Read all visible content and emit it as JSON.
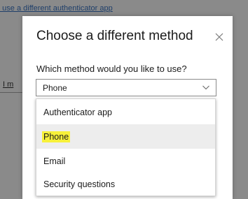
{
  "background": {
    "top_link": "o use a different authenticator app",
    "left_link": "I m"
  },
  "dialog": {
    "title": "Choose a different method",
    "close_icon": "close-icon",
    "question": "Which method would you like to use?",
    "select": {
      "value": "Phone",
      "chevron_icon": "chevron-down-icon"
    }
  },
  "dropdown": {
    "options": [
      {
        "label": "Authenticator app",
        "selected": false
      },
      {
        "label": "Phone",
        "selected": true,
        "highlighted": true
      },
      {
        "label": "Email",
        "selected": false
      },
      {
        "label": "Security questions",
        "selected": false
      }
    ]
  },
  "colors": {
    "overlay": "#6f6f6f",
    "highlight": "#f7f13a",
    "selected_row": "#ededed",
    "primary_button": "#0f5fb8"
  }
}
